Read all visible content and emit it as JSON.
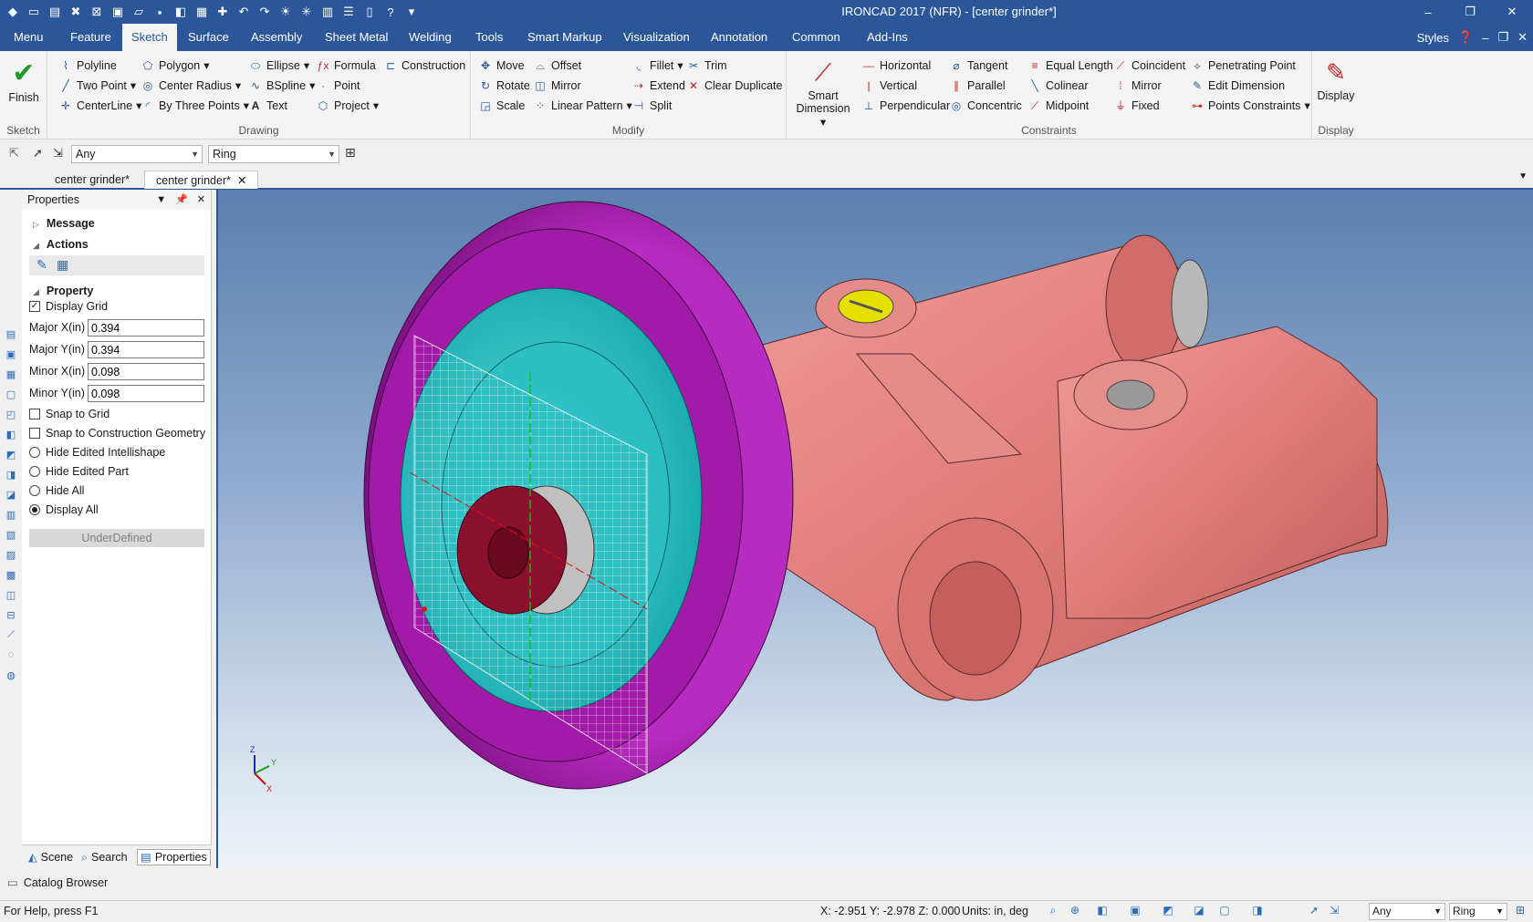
{
  "app": {
    "title": "IRONCAD 2017 (NFR) - [center grinder*]"
  },
  "menu_tabs": [
    "Menu",
    "Feature",
    "Sketch",
    "Surface",
    "Assembly",
    "Sheet Metal",
    "Welding",
    "Tools",
    "Smart Markup",
    "Visualization",
    "Annotation",
    "Common",
    "Add-Ins"
  ],
  "menu_right": {
    "styles": "Styles"
  },
  "ribbon": {
    "sketch_group": {
      "finish": "Finish",
      "label": "Sketch"
    },
    "drawing": {
      "label": "Drawing",
      "col1": [
        "Polyline",
        "Two Point",
        "CenterLine"
      ],
      "col2": [
        "Polygon",
        "Center Radius",
        "By Three Points"
      ],
      "col3": [
        "Ellipse",
        "BSpline",
        "Text"
      ],
      "col4": [
        "Formula",
        "Point",
        "Project"
      ],
      "col5": [
        "Construction"
      ]
    },
    "modify": {
      "label": "Modify",
      "col1": [
        "Move",
        "Rotate",
        "Scale"
      ],
      "col2": [
        "Offset",
        "Mirror",
        "Linear Pattern"
      ],
      "col3": [
        "Fillet",
        "Extend",
        "Split"
      ],
      "col4": [
        "Trim",
        "Clear Duplicate"
      ]
    },
    "constraints": {
      "label": "Constraints",
      "smart_dimension": "Smart Dimension",
      "col1": [
        "Horizontal",
        "Vertical",
        "Perpendicular"
      ],
      "col2": [
        "Tangent",
        "Parallel",
        "Concentric"
      ],
      "col3": [
        "Equal Length",
        "Colinear",
        "Midpoint"
      ],
      "col4": [
        "Coincident",
        "Mirror",
        "Fixed"
      ],
      "col5": [
        "Penetrating Point",
        "Edit Dimension",
        "Points Constraints"
      ]
    },
    "display": {
      "button": "Display",
      "label": "Display"
    }
  },
  "toolbar": {
    "filter1": "Any",
    "filter2": "Ring"
  },
  "doc_tabs": [
    "center grinder*",
    "center grinder*"
  ],
  "properties": {
    "title": "Properties",
    "sections": {
      "message": "Message",
      "actions": "Actions",
      "property": "Property"
    },
    "display_grid": "Display Grid",
    "fields": [
      {
        "label": "Major X(in)",
        "value": "0.394"
      },
      {
        "label": "Major Y(in)",
        "value": "0.394"
      },
      {
        "label": "Minor X(in)",
        "value": "0.098"
      },
      {
        "label": "Minor Y(in)",
        "value": "0.098"
      }
    ],
    "checks": [
      "Snap to Grid",
      "Snap to Construction Geometry"
    ],
    "radios": [
      "Hide Edited Intellishape",
      "Hide Edited Part",
      "Hide All",
      "Display All"
    ],
    "status": "UnderDefined",
    "bottom_tabs": [
      "Scene",
      "Search",
      "Properties"
    ]
  },
  "viewport": {
    "axis": {
      "z": "Z",
      "y": "Y",
      "x": "X"
    }
  },
  "catalog": "Catalog Browser",
  "status": {
    "help": "For Help, press F1",
    "coords": "X: -2.951 Y: -2.978 Z: 0.000",
    "units": "Units: in, deg",
    "filter1": "Any",
    "filter2": "Ring"
  },
  "colors": {
    "accent": "#2b579a",
    "wheel": "#a21aa8",
    "face": "#26c6c9",
    "body": "#e07d7b",
    "hub": "#8b1030",
    "screw": "#e6e000"
  }
}
